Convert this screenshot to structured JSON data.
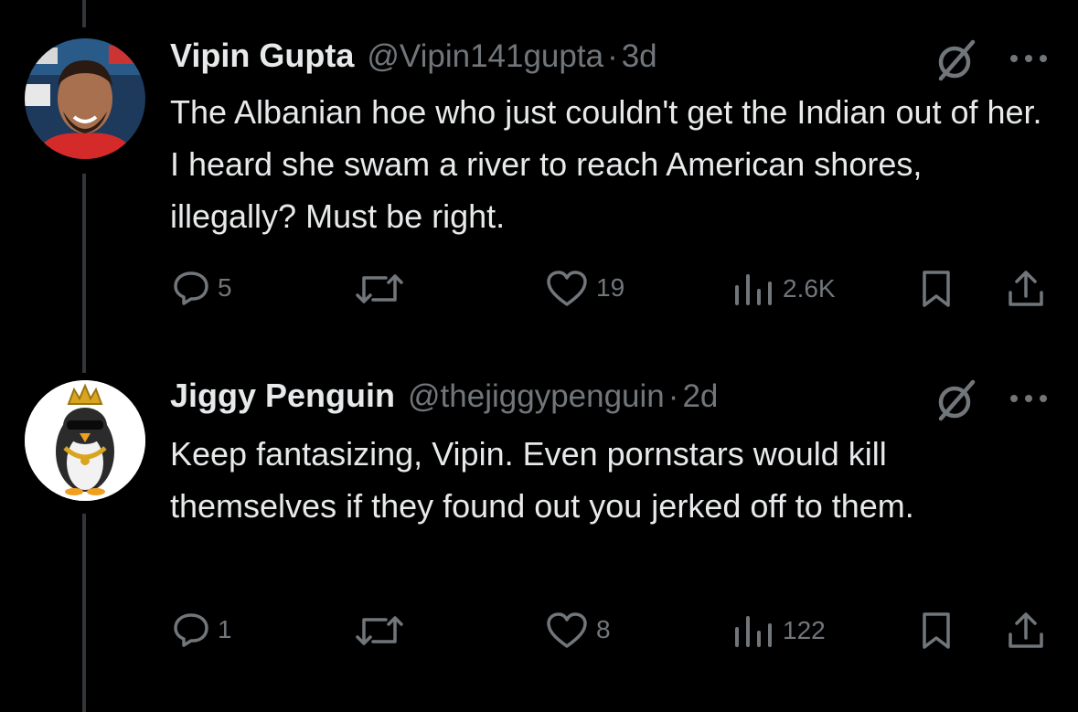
{
  "tweets": [
    {
      "name": "Vipin Gupta",
      "handle": "@Vipin141gupta",
      "separator": "·",
      "time": "3d",
      "text": "The Albanian hoe who just couldn't get the Indian out of her. I heard she swam a river to reach American shores, illegally? Must be right.",
      "replies": "5",
      "reposts": "",
      "likes": "19",
      "views": "2.6K",
      "avatar": "man-smiling-avatar"
    },
    {
      "name": "Jiggy Penguin",
      "handle": "@thejiggypenguin",
      "separator": "·",
      "time": "2d",
      "text": "Keep fantasizing, Vipin. Even pornstars would kill themselves if they found out you jerked off to them.",
      "replies": "1",
      "reposts": "",
      "likes": "8",
      "views": "122",
      "avatar": "penguin-with-crown-avatar"
    }
  ],
  "icons": {
    "reply": "reply-icon",
    "repost": "repost-icon",
    "like": "heart-icon",
    "views": "views-icon",
    "bookmark": "bookmark-icon",
    "share": "share-icon",
    "grok": "grok-icon",
    "more": "more-icon"
  },
  "colors": {
    "background": "#000000",
    "text": "#e7e9ea",
    "muted": "#71767b",
    "thread_line": "#333639"
  }
}
